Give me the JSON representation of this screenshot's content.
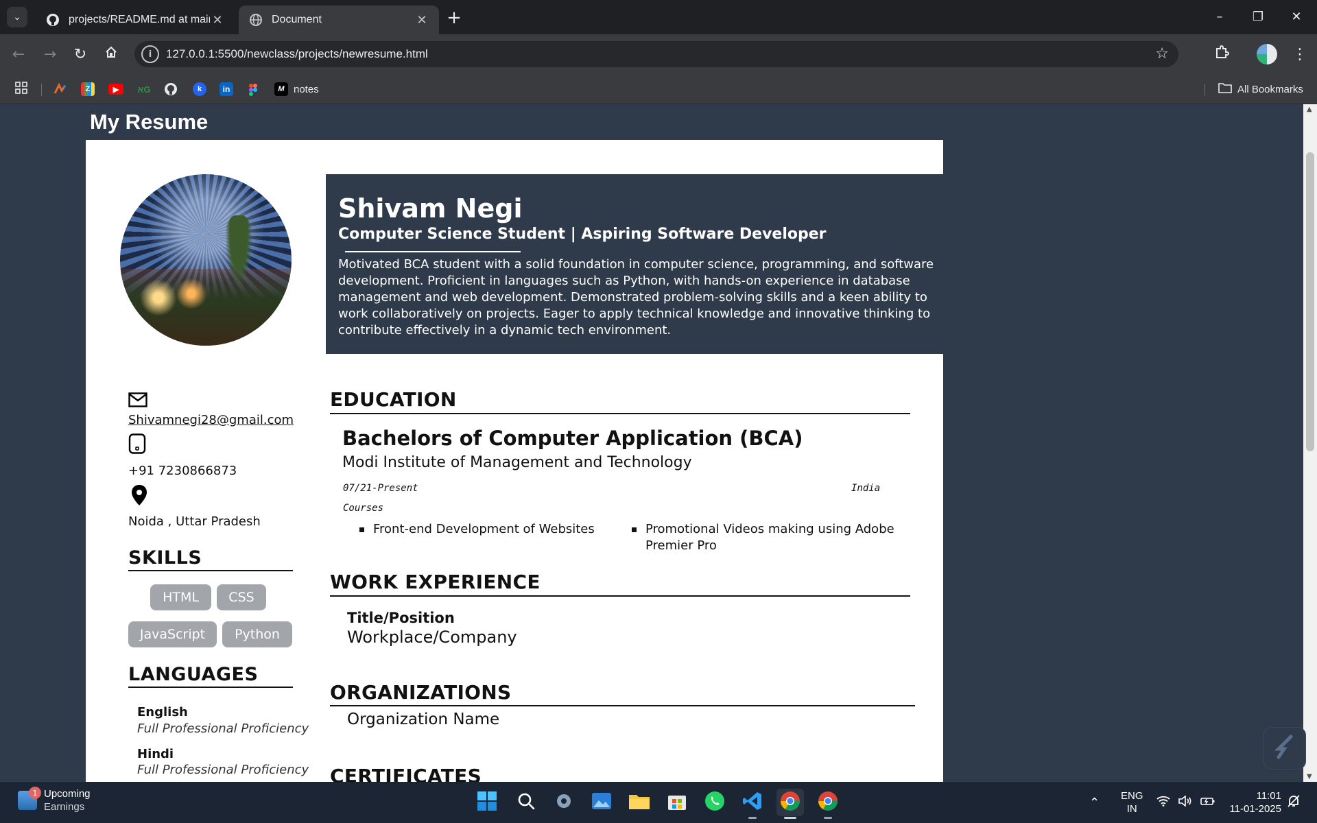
{
  "browser": {
    "tabs": [
      {
        "title": "projects/README.md at main · ",
        "icon": "github-icon",
        "active": false
      },
      {
        "title": "Document",
        "icon": "globe-icon",
        "active": true
      }
    ],
    "url": "127.0.0.1:5500/newclass/projects/newresume.html",
    "bookmarks": [
      {
        "label": "",
        "icon": "google-analytics-icon"
      },
      {
        "label": "",
        "icon": "zoho-icon"
      },
      {
        "label": "",
        "icon": "youtube-icon"
      },
      {
        "label": "",
        "icon": "geeksforgeeks-icon"
      },
      {
        "label": "",
        "icon": "github-icon"
      },
      {
        "label": "",
        "icon": "kaggle-icon"
      },
      {
        "label": "",
        "icon": "linkedin-icon"
      },
      {
        "label": "",
        "icon": "figma-icon"
      },
      {
        "label": "notes",
        "icon": "notion-icon"
      }
    ],
    "all_bookmarks_label": "All Bookmarks"
  },
  "page": {
    "heading": "My Resume",
    "name": "Shivam Negi",
    "role": "Computer Science Student | Aspiring Software Developer",
    "summary": "Motivated BCA student with a solid foundation in computer science, programming, and software development. Proficient in languages such as Python, with hands-on experience in database management and web development. Demonstrated problem-solving skills and a keen ability to work collaboratively on projects. Eager to apply technical knowledge and innovative thinking to contribute effectively in a dynamic tech environment.",
    "contact": {
      "email": "Shivamnegi28@gmail.com",
      "phone": "+91 7230866873",
      "location": "Noida , Uttar Pradesh"
    },
    "skills_heading": "SKILLS",
    "skills": [
      "HTML",
      "CSS",
      "JavaScript",
      "Python"
    ],
    "languages_heading": "LANGUAGES",
    "languages": [
      {
        "name": "English",
        "level": "Full Professional Proficiency"
      },
      {
        "name": "Hindi",
        "level": "Full Professional Proficiency"
      }
    ],
    "education": {
      "heading": "EDUCATION",
      "degree": "Bachelors of Computer Application (BCA)",
      "institute": "Modi Institute of Management and Technology",
      "dates": "07/21-Present",
      "country": "India",
      "courses_label": "Courses",
      "courses": [
        "Front-end Development of Websites",
        "Promotional Videos making using Adobe Premier Pro"
      ]
    },
    "work": {
      "heading": "WORK EXPERIENCE",
      "title": "Title/Position",
      "company": "Workplace/Company"
    },
    "organizations": {
      "heading": "ORGANIZATIONS",
      "name": "Organization Name"
    },
    "certificates_heading": "CERTIFICATES"
  },
  "taskbar": {
    "weather_title": "Upcoming",
    "weather_sub": "Earnings",
    "weather_badge": "1",
    "lang_top": "ENG",
    "lang_bottom": "IN",
    "time": "11:01",
    "date": "11-01-2025"
  },
  "colors": {
    "page_bg": "#2f3a4a",
    "chrome_dark": "#1f2023",
    "chrome_toolbar": "#3a3b3e",
    "skill_chip": "#a2a6ab",
    "taskbar": "#1c2533"
  }
}
